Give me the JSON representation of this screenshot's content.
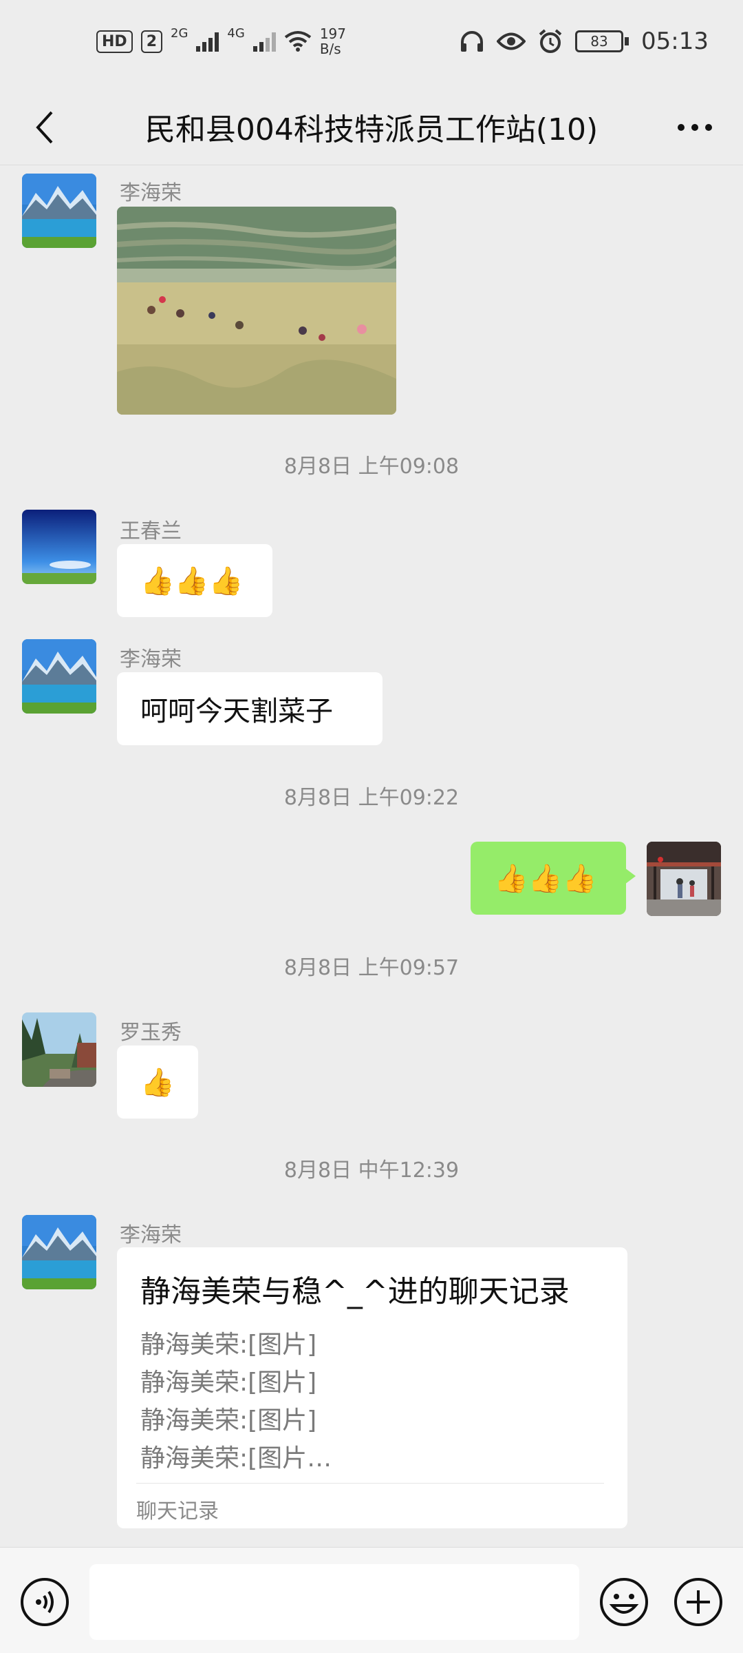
{
  "status_bar": {
    "hd_label": "HD",
    "sim_label": "2",
    "net1_label": "2G",
    "net2_label": "4G",
    "speed_value": "197",
    "speed_unit": "B/s",
    "battery_level": "83",
    "time": "05:13"
  },
  "header": {
    "title": "民和县004科技特派员工作站(10)"
  },
  "messages": {
    "m1": {
      "sender": "李海荣"
    },
    "t1": "8月8日 上午09:08",
    "m2": {
      "sender": "王春兰",
      "text": "👍👍👍"
    },
    "m3": {
      "sender": "李海荣",
      "text": "呵呵今天割菜子"
    },
    "t2": "8月8日 上午09:22",
    "m4": {
      "text": "👍👍👍"
    },
    "t3": "8月8日 上午09:57",
    "m5": {
      "sender": "罗玉秀",
      "text": "👍"
    },
    "t4": "8月8日 中午12:39",
    "m6": {
      "sender": "李海荣",
      "card_title": "静海美荣与稳^_^进的聊天记录",
      "lines": [
        "静海美荣:[图片]",
        "静海美荣:[图片]",
        "静海美荣:[图片]",
        "静海美荣:[图片…"
      ],
      "footer": "聊天记录"
    }
  },
  "input_bar": {
    "value": ""
  },
  "icons": {
    "back": "chevron-left-icon",
    "more": "more-icon",
    "voice": "voice-icon",
    "emoji": "emoji-icon",
    "plus": "plus-icon"
  },
  "colors": {
    "background": "#ededed",
    "bubble_self": "#95ec69",
    "bubble_other": "#ffffff"
  }
}
